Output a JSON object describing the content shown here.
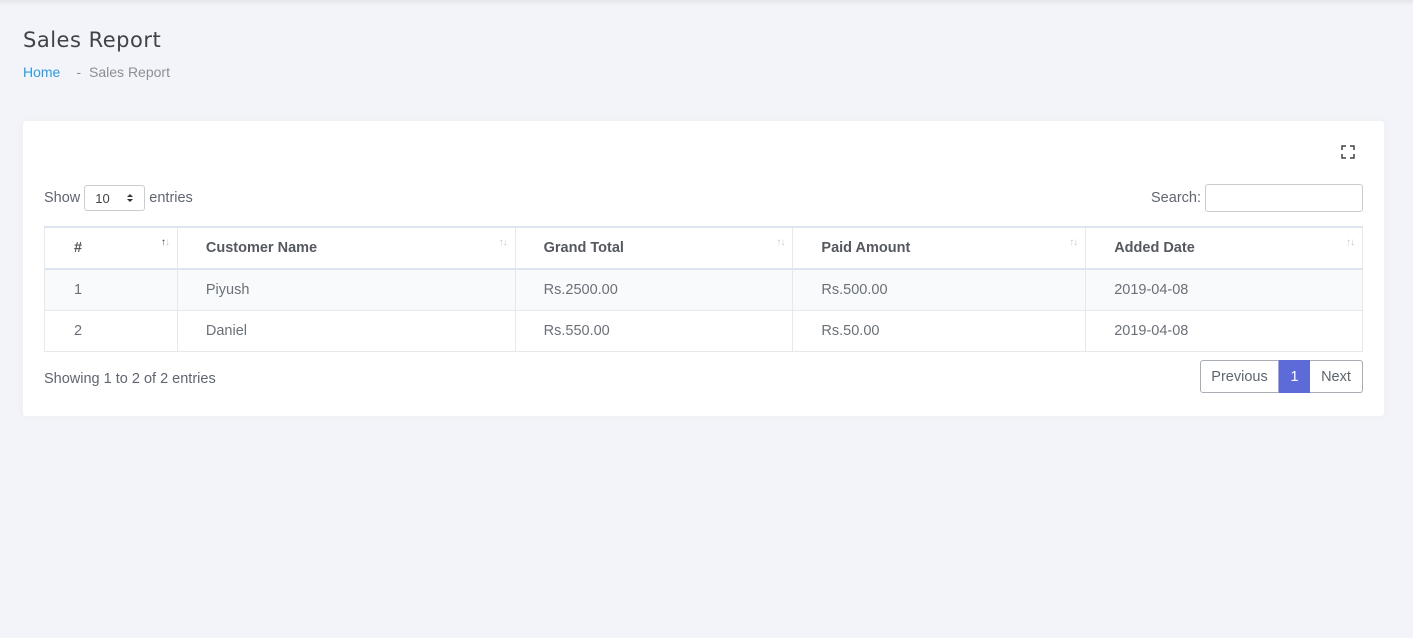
{
  "page": {
    "title": "Sales Report",
    "breadcrumb": {
      "home": "Home",
      "separator": "-",
      "current": "Sales Report"
    }
  },
  "table_controls": {
    "show_label": "Show",
    "entries_label": "entries",
    "page_length_value": "10",
    "search_label": "Search:",
    "search_value": "",
    "search_placeholder": ""
  },
  "table": {
    "columns": [
      "#",
      "Customer Name",
      "Grand Total",
      "Paid Amount",
      "Added Date"
    ],
    "sorted_column": "#",
    "sort_direction": "ascending",
    "rows": [
      [
        "1",
        "Piyush",
        "Rs.2500.00",
        "Rs.500.00",
        "2019-04-08"
      ],
      [
        "2",
        "Daniel",
        "Rs.550.00",
        "Rs.50.00",
        "2019-04-08"
      ]
    ]
  },
  "footer": {
    "info": "Showing 1 to 2 of 2 entries",
    "pagination": {
      "previous": "Previous",
      "current_page": "1",
      "next": "Next"
    }
  },
  "icons": {
    "fullscreen": "fullscreen-icon",
    "select_arrows": "select-arrows-icon",
    "sort": "sort-icon"
  },
  "colors": {
    "accent": "#5c6bd8",
    "link": "#2c9be0",
    "background": "#f3f4f9"
  }
}
